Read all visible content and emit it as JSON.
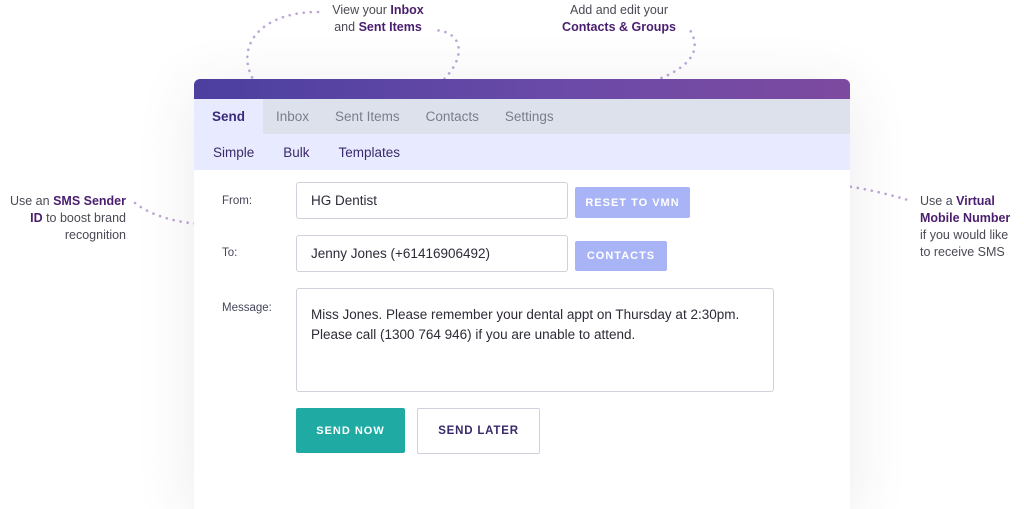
{
  "annotations": {
    "inbox": {
      "prefix": "View your ",
      "bold1": "Inbox",
      "mid": "and ",
      "bold2": "Sent Items"
    },
    "contacts": {
      "prefix": "Add and edit your",
      "bold": "Contacts & Groups"
    },
    "sender": {
      "prefix": "Use an ",
      "bold": "SMS Sender ID",
      "suffix": " to boost brand recognition"
    },
    "vmn": {
      "prefix": "Use a ",
      "bold": "Virtual Mobile Number",
      "suffix": " if you would like to receive SMS"
    }
  },
  "tabs": [
    {
      "label": "Send",
      "active": true
    },
    {
      "label": "Inbox"
    },
    {
      "label": "Sent Items"
    },
    {
      "label": "Contacts"
    },
    {
      "label": "Settings"
    }
  ],
  "subtabs": [
    "Simple",
    "Bulk",
    "Templates"
  ],
  "form": {
    "from_label": "From:",
    "from_value": "HG Dentist",
    "reset_button": "RESET TO VMN",
    "to_label": "To:",
    "to_value": "Jenny Jones (+61416906492)",
    "contacts_button": "CONTACTS",
    "message_label": "Message:",
    "message_value": "Miss Jones. Please remember your dental appt on Thursday at 2:30pm. Please call (1300 764 946) if you are unable to attend."
  },
  "actions": {
    "send_now": "SEND NOW",
    "send_later": "SEND LATER"
  },
  "colors": {
    "accent_purple": "#4a1e6e",
    "title_gradient_start": "#4b3f9f",
    "title_gradient_end": "#7d4a9f",
    "send_now": "#20aaa4",
    "soft_button": "#a8b4f6",
    "dots": "#b9a0d4"
  }
}
